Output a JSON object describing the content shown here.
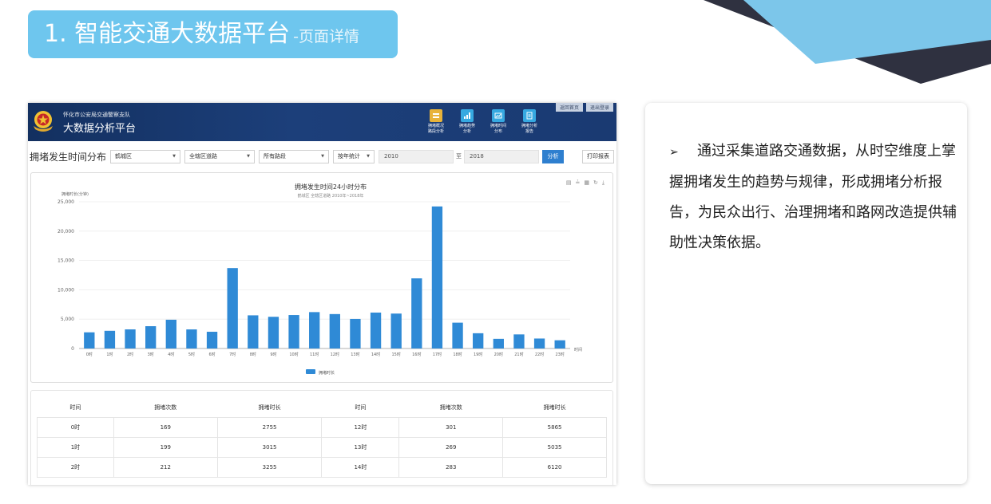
{
  "slide": {
    "title": "1. 智能交通大数据平台",
    "subtitle": "-页面详情",
    "description_bullet": "➢",
    "description": "通过采集道路交通数据，从时空维度上掌握拥堵发生的趋势与规律，形成拥堵分析报告，为民众出行、治理拥堵和路网改造提供辅助性决策依据。"
  },
  "app": {
    "org_name": "怀化市公安局交通警察支队",
    "platform_name": "大数据分析平台",
    "top_links": [
      "返回首页",
      "退出登录"
    ],
    "nav": [
      {
        "line1": "拥堵概况",
        "line2": "路段分析",
        "icon": "road-icon",
        "color": "#e8b33a"
      },
      {
        "line1": "拥堵趋势",
        "line2": "分析",
        "icon": "bar-chart-icon",
        "color": "#36a9e1"
      },
      {
        "line1": "拥堵时间",
        "line2": "分布",
        "icon": "clock-chart-icon",
        "color": "#36a9e1"
      },
      {
        "line1": "拥堵分析",
        "line2": "报告",
        "icon": "report-icon",
        "color": "#36a9e1"
      }
    ],
    "filters": {
      "page_title": "拥堵发生时间分布",
      "district": "鹤城区",
      "road_scope": "全辖区道路",
      "segment": "所有路段",
      "stat_mode": "按年统计",
      "year_from": "2010",
      "year_sep": "至",
      "year_to": "2018",
      "analyze_label": "分析",
      "print_label": "打印报表"
    },
    "chart_tools": [
      "▤",
      "≟",
      "▦",
      "↻",
      "⤓"
    ]
  },
  "chart_data": {
    "type": "bar",
    "title": "拥堵发生时间24小时分布",
    "subtitle": "鹤城区 全辖区道路 2010年~2018年",
    "ylabel": "拥堵时长(分钟)",
    "xlabel": "时间",
    "legend": "拥堵时长",
    "legend_position": "bottom",
    "ylim": [
      0,
      25000
    ],
    "yticks": [
      "0",
      "5,000",
      "10,000",
      "15,000",
      "20,000",
      "25,000"
    ],
    "color": "#2f8ad6",
    "categories": [
      "0时",
      "1时",
      "2时",
      "3时",
      "4时",
      "5时",
      "6时",
      "7时",
      "8时",
      "9时",
      "10时",
      "11时",
      "12时",
      "13时",
      "14时",
      "15时",
      "16时",
      "17时",
      "18时",
      "19时",
      "20时",
      "21时",
      "22时",
      "23时"
    ],
    "values": [
      2755,
      3015,
      3255,
      3800,
      4900,
      3250,
      2850,
      13700,
      5650,
      5400,
      5700,
      6200,
      5865,
      5035,
      6120,
      5950,
      11950,
      24200,
      4400,
      2600,
      1650,
      2400,
      1700,
      1400
    ]
  },
  "table": {
    "headers": [
      "时间",
      "拥堵次数",
      "拥堵时长",
      "时间",
      "拥堵次数",
      "拥堵时长"
    ],
    "rows": [
      [
        "0时",
        "169",
        "2755",
        "12时",
        "301",
        "5865"
      ],
      [
        "1时",
        "199",
        "3015",
        "13时",
        "269",
        "5035"
      ],
      [
        "2时",
        "212",
        "3255",
        "14时",
        "283",
        "6120"
      ]
    ]
  }
}
